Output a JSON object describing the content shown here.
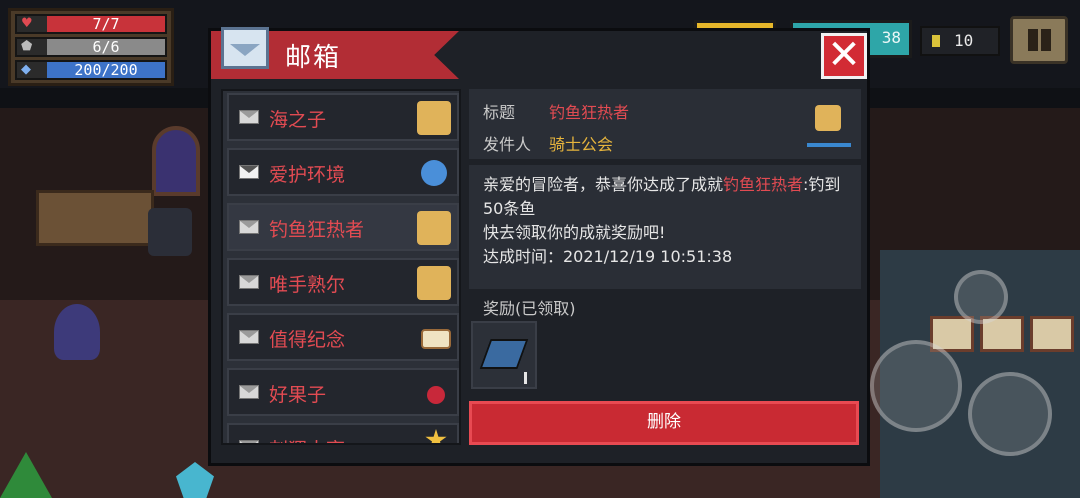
{
  "hud": {
    "hp": {
      "text": "7/7",
      "fraction": 1.0
    },
    "shield": {
      "text": "6/6",
      "fraction": 1.0
    },
    "energy": {
      "text": "200/200",
      "fraction": 1.0
    },
    "hp_icon": "heart-icon",
    "shield_icon": "shield-icon",
    "energy_icon": "diamond-icon",
    "gold": "10",
    "gems_partial": "38"
  },
  "modal": {
    "title": "邮箱",
    "close": "✕",
    "mail_icon_text": "C.R MAIL"
  },
  "mails": [
    {
      "label": "海之子",
      "read": true,
      "thumb": "fisher-kid"
    },
    {
      "label": "爱护环境",
      "read": false,
      "thumb": "globe-hands"
    },
    {
      "label": "钓鱼狂热者",
      "read": true,
      "thumb": "fisher",
      "selected": true
    },
    {
      "label": "唯手熟尔",
      "read": true,
      "thumb": "fisher"
    },
    {
      "label": "值得纪念",
      "read": true,
      "thumb": "doc"
    },
    {
      "label": "好果子",
      "read": true,
      "thumb": "cherry"
    },
    {
      "label": "刺猬大亨",
      "read": true,
      "thumb": "star"
    }
  ],
  "detail": {
    "title_key": "标题",
    "title_value": "钓鱼狂热者",
    "sender_key": "发件人",
    "sender_value": "骑士公会",
    "body_pre": "亲爱的冒险者，恭喜你达成了成就",
    "body_hl": "钓鱼狂热者",
    "body_post": ":钓到50条鱼",
    "body_line2": "快去领取你的成就奖励吧!",
    "body_time": "达成时间：2021/12/19 10:51:38",
    "reward_label": "奖励(已领取)",
    "delete_label": "删除"
  }
}
